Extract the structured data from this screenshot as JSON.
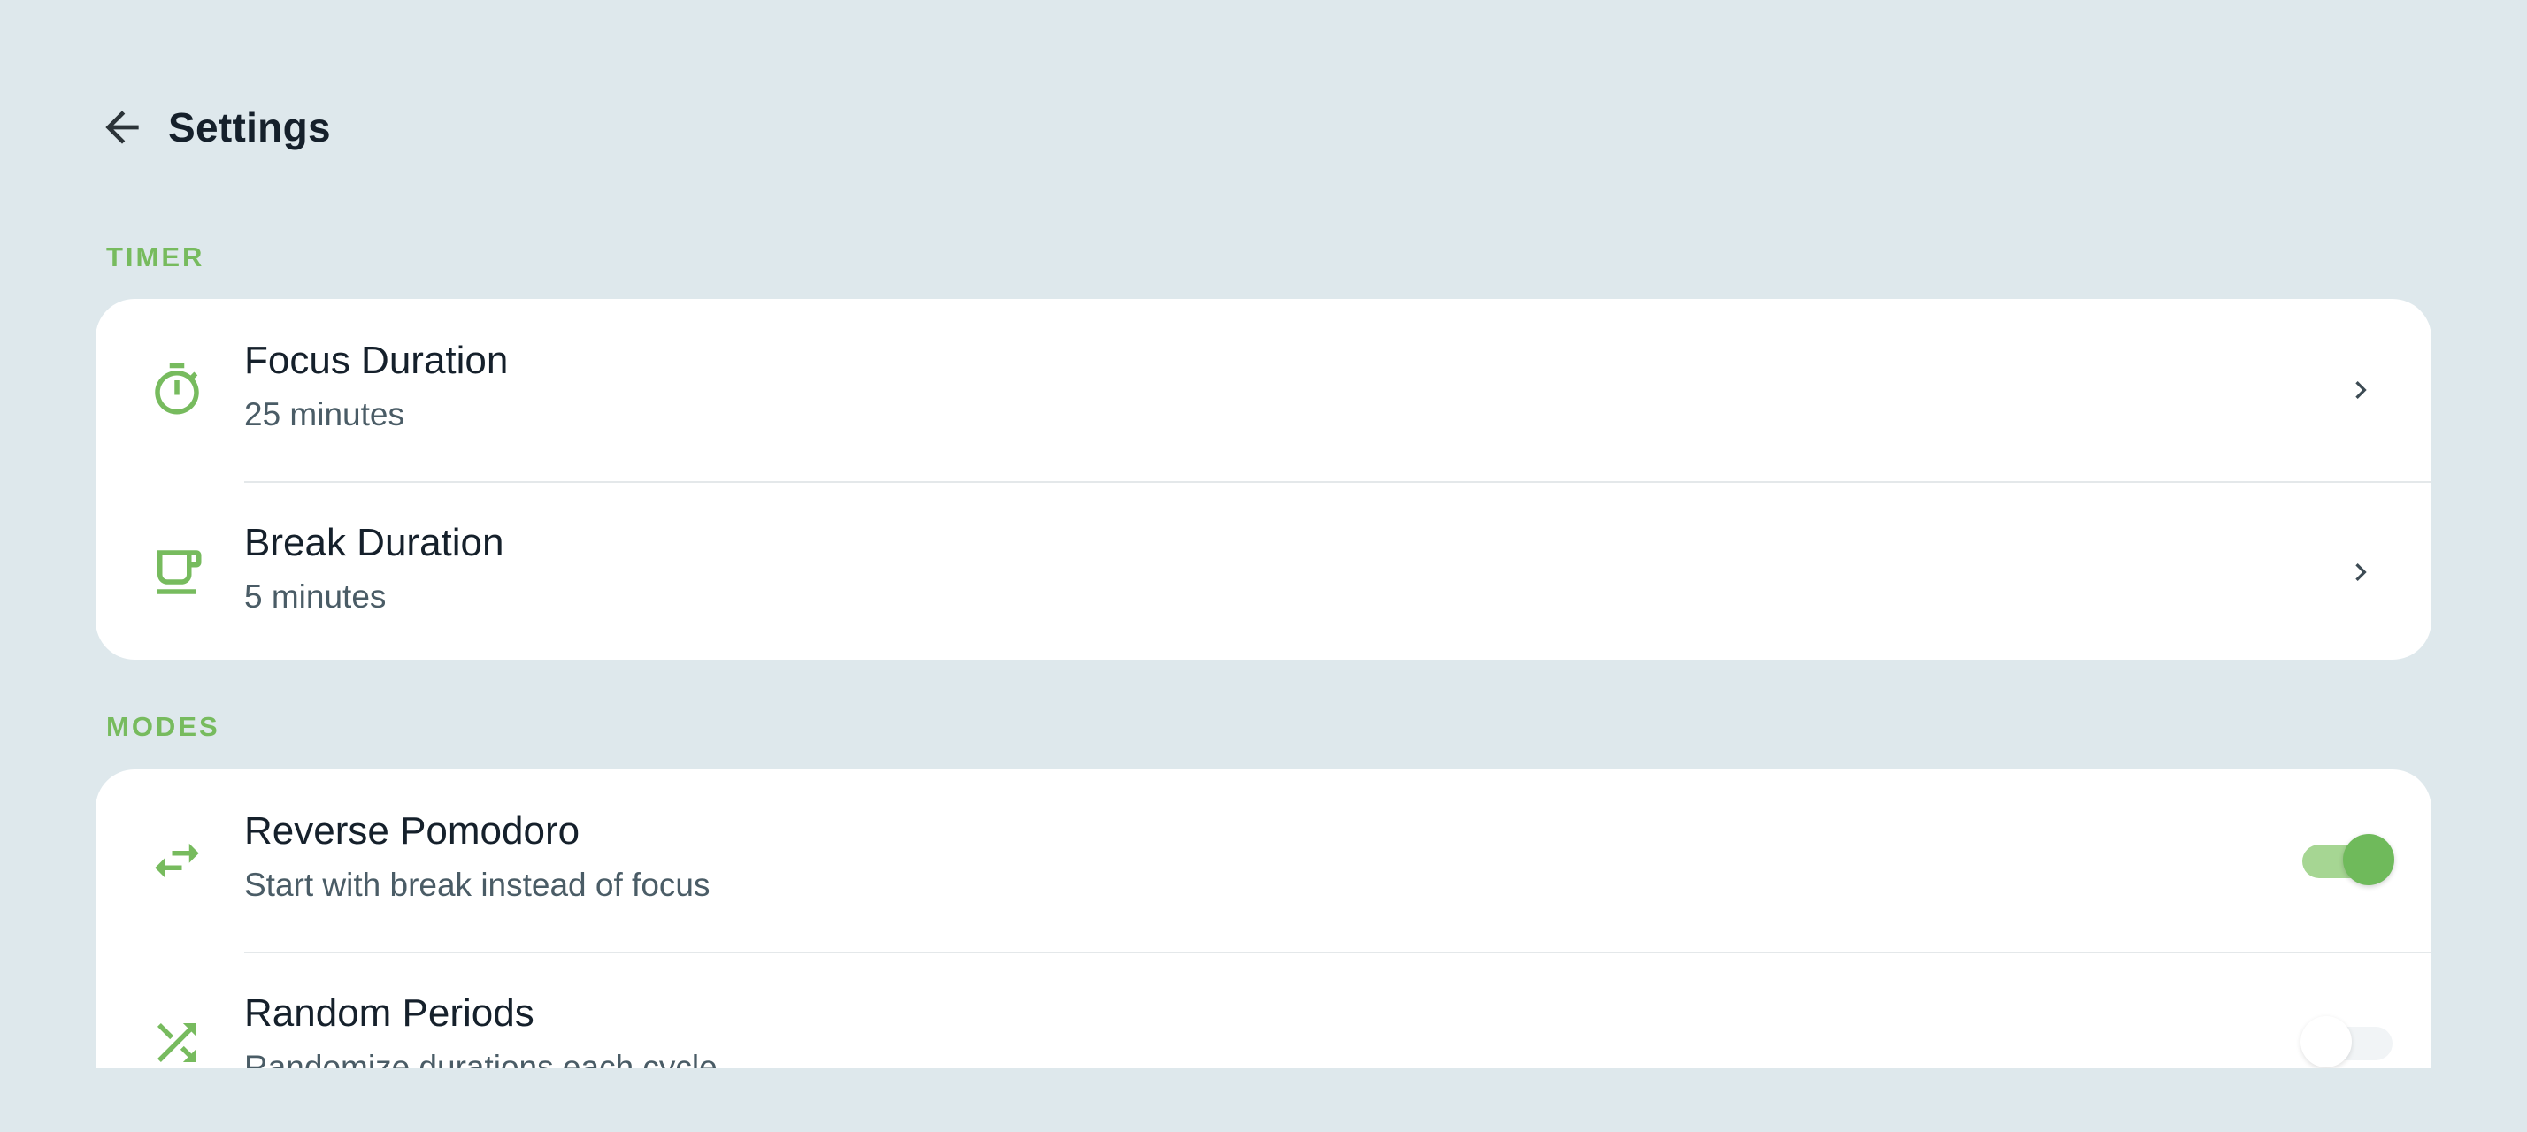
{
  "header": {
    "title": "Settings"
  },
  "sections": {
    "timer": {
      "label": "TIMER",
      "items": [
        {
          "title": "Focus Duration",
          "subtitle": "25 minutes",
          "icon": "timer-icon"
        },
        {
          "title": "Break Duration",
          "subtitle": "5 minutes",
          "icon": "coffee-cup-icon"
        }
      ]
    },
    "modes": {
      "label": "MODES",
      "items": [
        {
          "title": "Reverse Pomodoro",
          "subtitle": "Start with break instead of focus",
          "icon": "swap-arrows-icon",
          "enabled": true
        },
        {
          "title": "Random Periods",
          "subtitle": "Randomize durations each cycle",
          "icon": "shuffle-icon",
          "enabled": false
        }
      ]
    }
  },
  "colors": {
    "background": "#dee8ec",
    "card": "#ffffff",
    "accent": "#77bb5e",
    "title_text": "#15202b",
    "subtitle_text": "#4a5c66"
  }
}
